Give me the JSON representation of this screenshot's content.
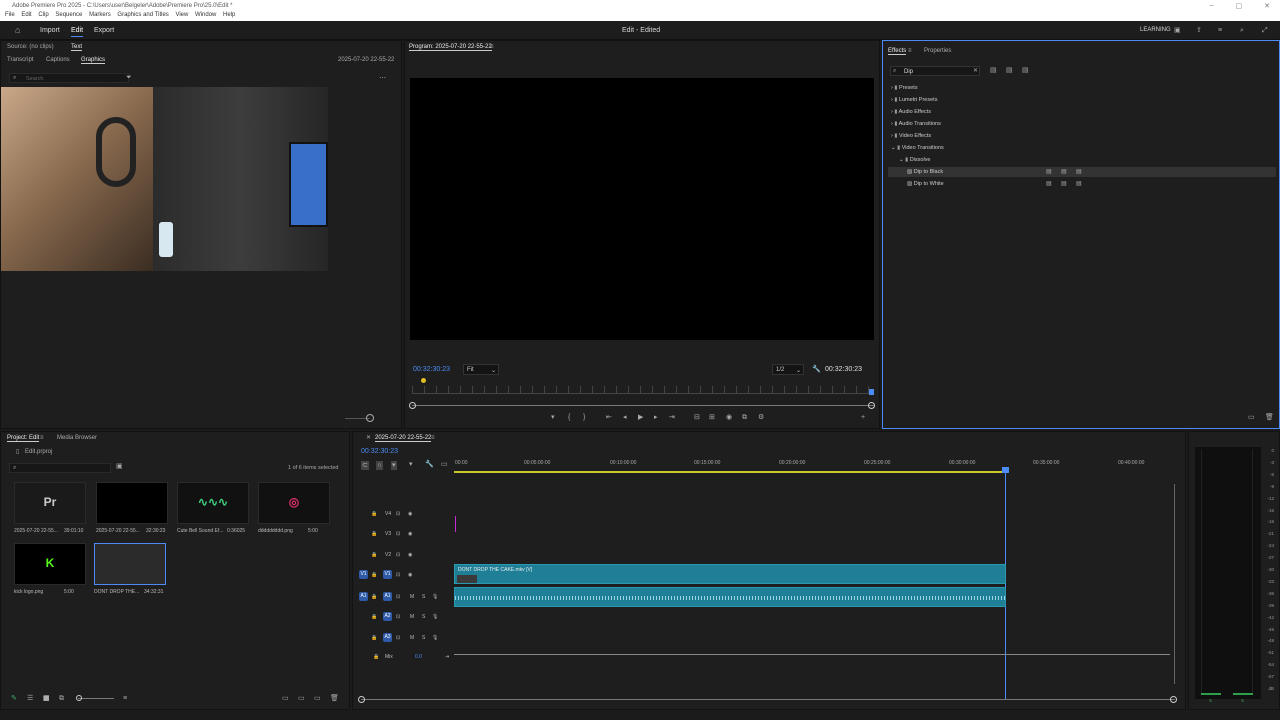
{
  "titlebar": {
    "title": "Adobe Premiere Pro 2025 - C:\\Users\\user\\Belgeler\\Adobe\\Premiere Pro\\25.0\\Edit *"
  },
  "menu": [
    "File",
    "Edit",
    "Clip",
    "Sequence",
    "Markers",
    "Graphics and Titles",
    "View",
    "Window",
    "Help"
  ],
  "appbar": {
    "import": "Import",
    "edit": "Edit",
    "export": "Export",
    "center_title": "Edit - Edited",
    "learning": "LEARNING"
  },
  "source_panel": {
    "source_label": "Source: (no clips)",
    "text_tab": "Text",
    "tabs": [
      "Transcript",
      "Captions",
      "Graphics"
    ],
    "sequence_name": "2025-07-20 22-55-22",
    "search_placeholder": "Search"
  },
  "program_monitor": {
    "title": "Program: 2025-07-20 22-55-22",
    "timecode_left": "00:32:30:23",
    "fit": "Fit",
    "quality": "1/2",
    "timecode_right": "00:32:30:23"
  },
  "effects": {
    "tabs": [
      "Effects",
      "Properties"
    ],
    "search_value": "Dip",
    "tree": [
      {
        "label": "Presets",
        "indent": 0,
        "expanded": false
      },
      {
        "label": "Lumetri Presets",
        "indent": 0,
        "expanded": false
      },
      {
        "label": "Audio Effects",
        "indent": 0,
        "expanded": false
      },
      {
        "label": "Audio Transitions",
        "indent": 0,
        "expanded": false
      },
      {
        "label": "Video Effects",
        "indent": 0,
        "expanded": false
      },
      {
        "label": "Video Transitions",
        "indent": 0,
        "expanded": true
      },
      {
        "label": "Dissolve",
        "indent": 1,
        "expanded": true
      },
      {
        "label": "Dip to Black",
        "indent": 2,
        "selected": true
      },
      {
        "label": "Dip to White",
        "indent": 2
      }
    ]
  },
  "project": {
    "tabs": [
      "Project: Edit",
      "Media Browser"
    ],
    "file": "Edit.prproj",
    "items_selected": "1 of 6 items selected",
    "items": [
      {
        "name": "2025-07-20 22-55...",
        "duration": "39:01:10"
      },
      {
        "name": "2025-07-20 22-55...",
        "duration": "32:30:23"
      },
      {
        "name": "Cute Bell Sound Ef...",
        "duration": "0:36025"
      },
      {
        "name": "ddddddddd.png",
        "duration": "5:00"
      },
      {
        "name": "kick logo.png",
        "duration": "5:00"
      },
      {
        "name": "DONT DROP THE...",
        "duration": "34:32:31"
      }
    ]
  },
  "timeline": {
    "sequence_tab": "2025-07-20 22-55-22",
    "timecode": "00:32:30:23",
    "ruler": [
      "00:00",
      "00:05:00:00",
      "00:10:00:00",
      "00:15:00:00",
      "00:20:00:00",
      "00:25:00:00",
      "00:30:00:00",
      "00:35:00:00",
      "00:40:00:00"
    ],
    "video_tracks": [
      "V4",
      "V3",
      "V2",
      "V1"
    ],
    "audio_tracks": [
      "A1",
      "A2",
      "A3"
    ],
    "mix_label": "Mix",
    "mix_value": "0.0",
    "clip_name": "DONT DROP THE CAKE.mkv [V]"
  },
  "meters": {
    "labels": [
      "0",
      "-3",
      "-6",
      "-9",
      "-12",
      "-15",
      "-18",
      "-21",
      "-24",
      "-27",
      "-30",
      "-33",
      "-36",
      "-39",
      "-42",
      "-45",
      "-48",
      "-51",
      "-54",
      "-57",
      "dB"
    ],
    "bottom": [
      "S",
      "S"
    ]
  },
  "colors": {
    "accent": "#4c8bf5",
    "clip_video": "#1e7f96",
    "clip_audio": "#1e7f96",
    "playhead": "#4c8bf5"
  }
}
